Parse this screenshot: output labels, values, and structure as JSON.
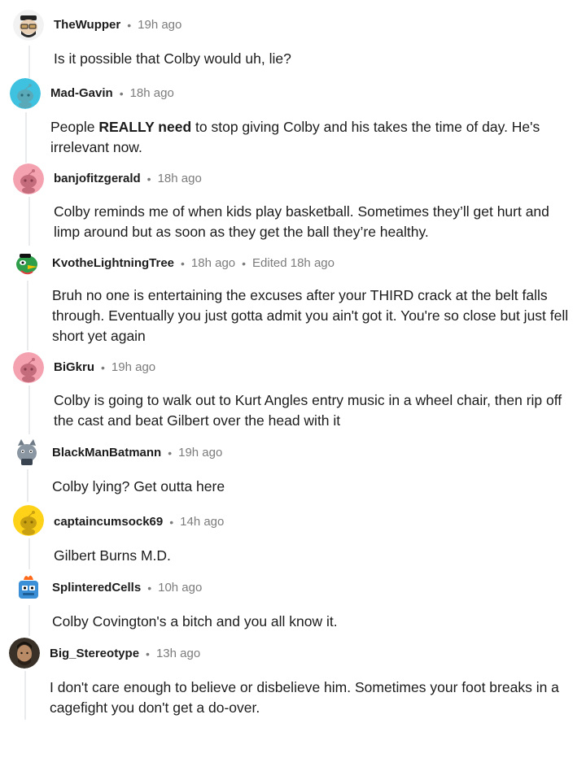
{
  "comments": [
    {
      "username": "TheWupper",
      "time": "19h ago",
      "edited": "",
      "text": "Is it possible that Colby would uh, lie?"
    },
    {
      "username": "Mad-Gavin",
      "time": "18h ago",
      "edited": "",
      "text_before": "People ",
      "text_bold": "REALLY need",
      "text_after": " to stop giving Colby and his takes the time of day. He's irrelevant now."
    },
    {
      "username": "banjofitzgerald",
      "time": "18h ago",
      "edited": "",
      "text": "Colby reminds me of when kids play basketball. Sometimes they’ll get hurt and limp around but as soon as they get the ball they’re healthy."
    },
    {
      "username": "KvotheLightningTree",
      "time": "18h ago",
      "edited": "Edited 18h ago",
      "text": "Bruh no one is entertaining the excuses after your THIRD crack at the belt falls through. Eventually you just gotta admit you ain't got it. You're so close but just fell short yet again"
    },
    {
      "username": "BiGkru",
      "time": "19h ago",
      "edited": "",
      "text": "Colby is going to walk out to Kurt Angles entry music in a wheel chair, then rip off the cast and beat Gilbert over the head with it"
    },
    {
      "username": "BlackManBatmann",
      "time": "19h ago",
      "edited": "",
      "text": "Colby lying? Get outta here"
    },
    {
      "username": "captaincumsock69",
      "time": "14h ago",
      "edited": "",
      "text": "Gilbert Burns M.D."
    },
    {
      "username": "SplinteredCells",
      "time": "10h ago",
      "edited": "",
      "text": "Colby Covington's a bitch and you all know it."
    },
    {
      "username": "Big_Stereotype",
      "time": "13h ago",
      "edited": "",
      "text": "I don't care enough to believe or disbelieve him. Sometimes your foot breaks in a cagefight you don't get a do-over."
    }
  ],
  "separator": "•",
  "colors": {
    "meta": "#7c7c7c",
    "thread_line": "#e9ebed",
    "text": "#1c1c1c"
  },
  "icons": [
    "snoo-avatar-hat-glasses",
    "snoo-avatar-blue",
    "snoo-avatar-pink",
    "snoo-avatar-green-bird",
    "snoo-avatar-pink",
    "snoo-avatar-grey-cat",
    "snoo-avatar-yellow",
    "snoo-avatar-blue-robot-fire",
    "photo-avatar-man"
  ]
}
